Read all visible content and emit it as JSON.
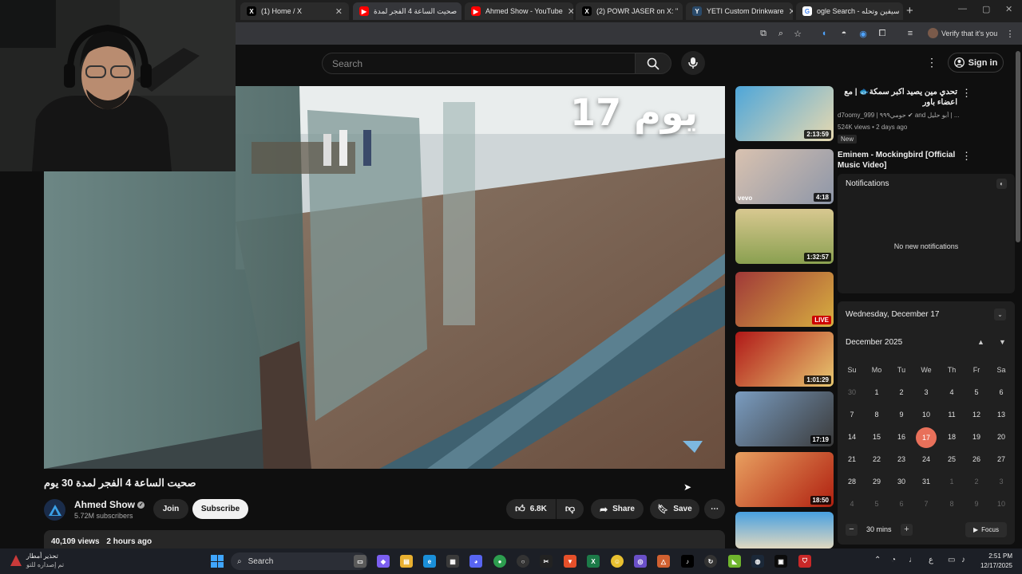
{
  "browser": {
    "tabs": [
      {
        "label": "(1) Home / X",
        "favicon": "x-logo-icon",
        "active": false
      },
      {
        "label": "صحيت الساعة 4 الفجر لمدة",
        "favicon": "youtube-icon",
        "active": true
      },
      {
        "label": "Ahmed Show - YouTube",
        "favicon": "youtube-icon",
        "active": false
      },
      {
        "label": "(2) POWR JASER on X: \"",
        "favicon": "x-logo-icon",
        "active": false
      },
      {
        "label": "YETI Custom Drinkware",
        "favicon": "yeti-icon",
        "active": false
      },
      {
        "label": "ogle Search - سيفين وتحله",
        "favicon": "google-icon",
        "active": false
      }
    ],
    "toolbar": {
      "profile_label": "Verify that it's you"
    }
  },
  "youtube": {
    "search_placeholder": "Search",
    "signin_label": "Sign in",
    "video": {
      "overlay_text": "يوم 17",
      "title": "صحيت الساعة 4 الفجر لمدة 30 يوم",
      "channel_name": "Ahmed Show",
      "subscribers": "5.72M subscribers",
      "join_label": "Join",
      "subscribe_label": "Subscribe",
      "likes": "6.8K",
      "share_label": "Share",
      "save_label": "Save",
      "views": "40,109 views",
      "uploaded": "2 hours ago"
    },
    "recommendations": [
      {
        "title": "تحدي مين يصيد اكبر سمكة🐟 | مع اعضاء باور",
        "meta": "d7oomy_999 | حومي٩٩٩ ✔ and أبو حليل | ...",
        "views": "524K views • 2 days ago",
        "badge": "New",
        "duration": "2:13:59"
      },
      {
        "title": "Eminem - Mockingbird [Official Music Video]",
        "meta": "",
        "views": "",
        "badge": "",
        "duration": "4:18"
      },
      {
        "title": "",
        "meta": "",
        "views": "",
        "badge": "",
        "duration": "1:32:57"
      },
      {
        "title": "",
        "meta": "",
        "views": "",
        "badge": "",
        "duration": "LIVE"
      },
      {
        "title": "",
        "meta": "",
        "views": "",
        "badge": "",
        "duration": "1:01:29"
      },
      {
        "title": "",
        "meta": "",
        "views": "",
        "badge": "",
        "duration": "17:19"
      },
      {
        "title": "",
        "meta": "",
        "views": "",
        "badge": "",
        "duration": "18:50"
      },
      {
        "title": "",
        "meta": "",
        "views": "",
        "badge": "",
        "duration": ""
      }
    ]
  },
  "windows": {
    "notifications": {
      "header": "Notifications",
      "empty_text": "No new notifications"
    },
    "calendar": {
      "date_header": "Wednesday, December 17",
      "month_label": "December 2025",
      "weekdays": [
        "Su",
        "Mo",
        "Tu",
        "We",
        "Th",
        "Fr",
        "Sa"
      ],
      "rows": [
        [
          "30",
          "1",
          "2",
          "3",
          "4",
          "5",
          "6"
        ],
        [
          "7",
          "8",
          "9",
          "10",
          "11",
          "12",
          "13"
        ],
        [
          "14",
          "15",
          "16",
          "17",
          "18",
          "19",
          "20"
        ],
        [
          "21",
          "22",
          "23",
          "24",
          "25",
          "26",
          "27"
        ],
        [
          "28",
          "29",
          "30",
          "31",
          "1",
          "2",
          "3"
        ],
        [
          "4",
          "5",
          "6",
          "7",
          "8",
          "9",
          "10"
        ]
      ],
      "selected_day": "17",
      "focus_minutes": "30 mins",
      "focus_label": "Focus"
    },
    "taskbar": {
      "weather_line1": "تحذير أمطار",
      "weather_line2": "تم إصداره للتو",
      "search_label": "Search",
      "time": "2:51 PM",
      "date": "12/17/2025",
      "lang": "ع"
    }
  },
  "colors": {
    "youtube_red": "#ff0000",
    "selected_day": "#e8705a",
    "background": "#0f0f0f"
  }
}
